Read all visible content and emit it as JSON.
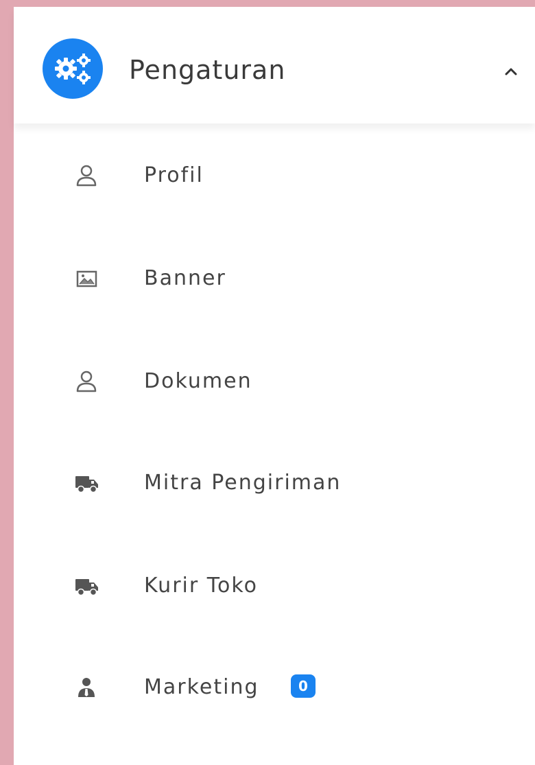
{
  "header": {
    "title": "Pengaturan",
    "icon": "settings-cogs-icon",
    "chevron_icon": "chevron-up-icon",
    "accent_color": "#1a83f0"
  },
  "menu": {
    "items": [
      {
        "label": "Profil",
        "icon": "user-outline-icon"
      },
      {
        "label": "Banner",
        "icon": "image-icon"
      },
      {
        "label": "Dokumen",
        "icon": "user-outline-icon"
      },
      {
        "label": "Mitra Pengiriman",
        "icon": "truck-icon"
      },
      {
        "label": "Kurir Toko",
        "icon": "truck-icon"
      },
      {
        "label": "Marketing",
        "icon": "user-tie-icon",
        "badge": "0"
      }
    ]
  },
  "colors": {
    "background": "#e1a8b2",
    "panel": "#ffffff",
    "text": "#444444",
    "badge": "#1a83f0"
  }
}
